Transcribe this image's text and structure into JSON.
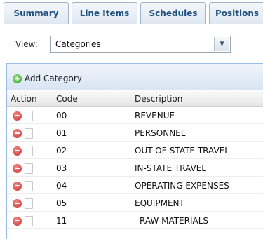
{
  "tabs": [
    {
      "label": "Summary"
    },
    {
      "label": "Line Items"
    },
    {
      "label": "Schedules"
    },
    {
      "label": "Positions"
    }
  ],
  "view": {
    "label": "View:",
    "selected": "Categories"
  },
  "toolbar": {
    "add_label": "Add Category"
  },
  "grid": {
    "columns": {
      "action": "Action",
      "code": "Code",
      "description": "Description"
    },
    "rows": [
      {
        "code": "00",
        "description": "REVENUE"
      },
      {
        "code": "01",
        "description": "PERSONNEL"
      },
      {
        "code": "02",
        "description": "OUT-OF-STATE TRAVEL"
      },
      {
        "code": "03",
        "description": "IN-STATE TRAVEL"
      },
      {
        "code": "04",
        "description": "OPERATING EXPENSES"
      },
      {
        "code": "05",
        "description": "EQUIPMENT"
      },
      {
        "code": "11",
        "description": "RAW MATERIALS"
      }
    ]
  },
  "colors": {
    "tab_text": "#1f4f7e",
    "panel_border": "#99bbe8",
    "delete_icon": "#cc2b2b",
    "add_icon": "#3a9c2a"
  },
  "icons": {
    "add": "add-circle-icon",
    "delete": "minus-circle-icon",
    "edit": "document-icon",
    "dropdown": "chevron-down-icon"
  }
}
